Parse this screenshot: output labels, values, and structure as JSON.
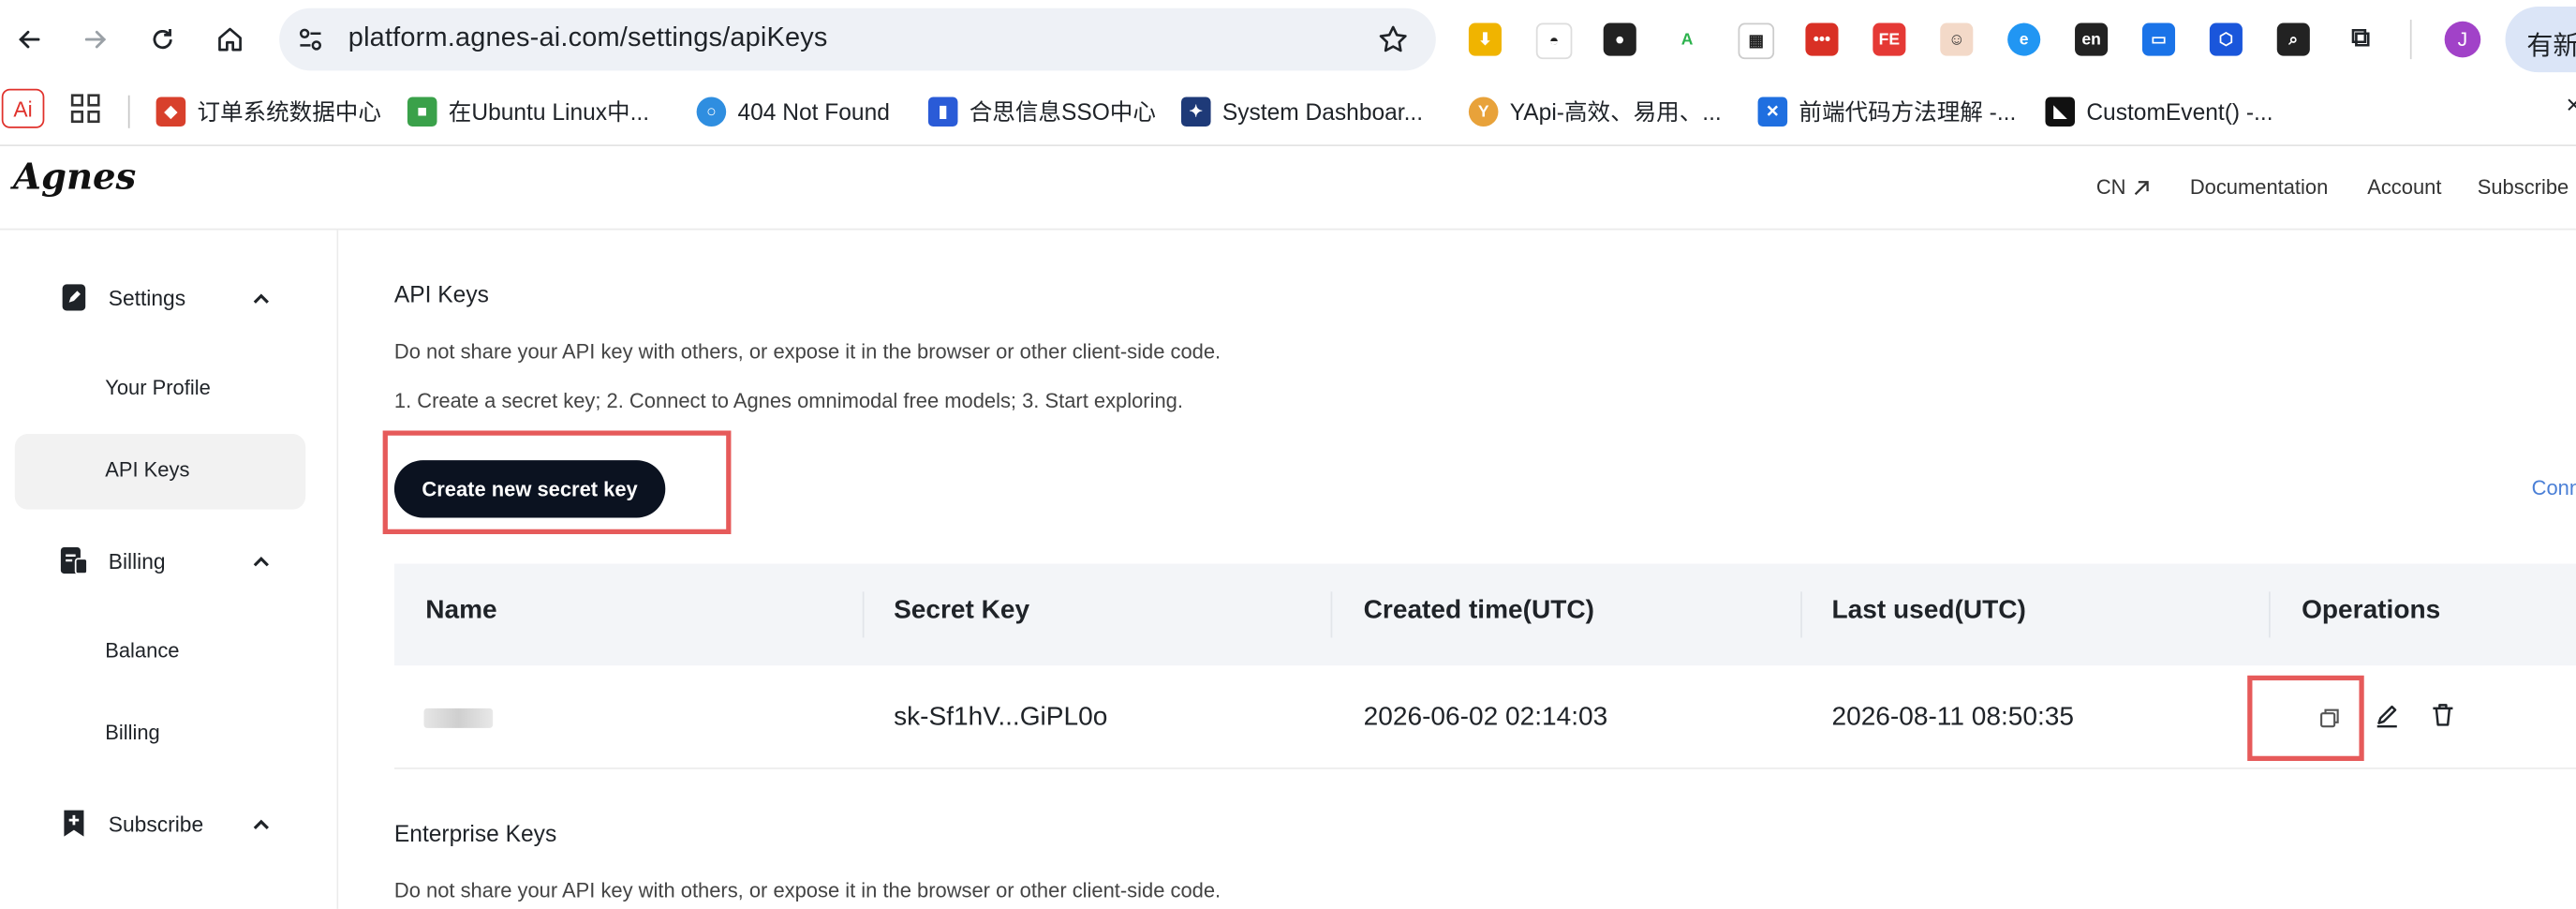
{
  "browser": {
    "url": "platform.agnes-ai.com/settings/apiKeys",
    "profile_initial": "J",
    "new_button_label": "有新",
    "ai_badge": "Ai",
    "bookmarks": [
      {
        "label": "订单系统数据中心",
        "color": "#d8402c"
      },
      {
        "label": "在Ubuntu Linux中...",
        "color": "#3aa14a"
      },
      {
        "label": "404 Not Found",
        "color": "#2f8ee0"
      },
      {
        "label": "合思信息SSO中心",
        "color": "#2a5bd7"
      },
      {
        "label": "System Dashboar...",
        "color": "#1e3a78"
      },
      {
        "label": "YApi-高效、易用、...",
        "color": "#e8a23a"
      },
      {
        "label": "前端代码方法理解 -...",
        "color": "#1f6fe0"
      },
      {
        "label": "CustomEvent() -...",
        "color": "#111111"
      }
    ]
  },
  "header": {
    "logo_text": "Agnes",
    "nav": {
      "cn": "CN",
      "documentation": "Documentation",
      "account": "Account",
      "subscribe": "Subscribe"
    }
  },
  "sidebar": {
    "groups": [
      {
        "label": "Settings",
        "icon": "settings-doc-icon"
      },
      {
        "label": "Billing",
        "icon": "billing-icon"
      },
      {
        "label": "Subscribe",
        "icon": "subscribe-icon"
      }
    ],
    "items": {
      "your_profile": "Your Profile",
      "api_keys": "API Keys",
      "balance": "Balance",
      "billing": "Billing"
    }
  },
  "main": {
    "api_title": "API Keys",
    "api_desc": "Do not share your API key with others, or expose it in the browser or other client-side code.",
    "steps": "1. Create a secret key; 2. Connect to Agnes omnimodal free models; 3. Start exploring.",
    "create_button": "Create new secret key",
    "conn_link": "Conn",
    "table": {
      "headers": [
        "Name",
        "Secret Key",
        "Created time(UTC)",
        "Last used(UTC)",
        "Operations"
      ],
      "rows": [
        {
          "secret_key": "sk-Sf1hV...GiPL0o",
          "created": "2026-06-02 02:14:03",
          "last_used": "2026-08-11 08:50:35"
        }
      ]
    },
    "enterprise_title": "Enterprise Keys",
    "enterprise_desc": "Do not share your API key with others, or expose it in the browser or other client-side code."
  }
}
